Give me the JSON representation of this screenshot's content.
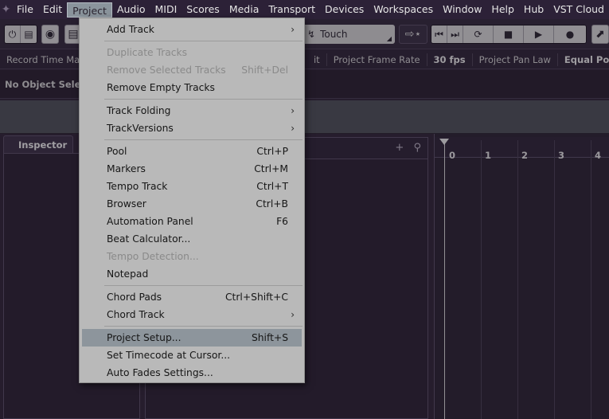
{
  "menubar": {
    "items": [
      "File",
      "Edit",
      "Project",
      "Audio",
      "MIDI",
      "Scores",
      "Media",
      "Transport",
      "Devices",
      "Workspaces",
      "Window",
      "Help",
      "Hub",
      "VST Cloud"
    ],
    "active": "Project"
  },
  "toolbar": {
    "automation_mode": "Touch"
  },
  "infoline": {
    "record_time_label": "Record Time Max",
    "cut_label": "it",
    "frame_rate_label": "Project Frame Rate",
    "frame_rate_value": "30 fps",
    "pan_law_label": "Project Pan Law",
    "pan_law_value": "Equal Power"
  },
  "event_line": {
    "status": "No Object Selected"
  },
  "inspector": {
    "tab_label": "Inspector"
  },
  "ruler": {
    "ticks": [
      "0",
      "1",
      "2",
      "3",
      "4"
    ]
  },
  "project_menu": {
    "items": [
      {
        "label": "Add Track",
        "shortcut": "",
        "submenu": true,
        "disabled": false,
        "highlight": false
      },
      {
        "label": "Duplicate Tracks",
        "shortcut": "",
        "submenu": false,
        "disabled": true,
        "highlight": false
      },
      {
        "label": "Remove Selected Tracks",
        "shortcut": "Shift+Del",
        "submenu": false,
        "disabled": true,
        "highlight": false
      },
      {
        "label": "Remove Empty Tracks",
        "shortcut": "",
        "submenu": false,
        "disabled": false,
        "highlight": false
      },
      {
        "label": "Track Folding",
        "shortcut": "",
        "submenu": true,
        "disabled": false,
        "highlight": false
      },
      {
        "label": "TrackVersions",
        "shortcut": "",
        "submenu": true,
        "disabled": false,
        "highlight": false
      },
      {
        "label": "Pool",
        "shortcut": "Ctrl+P",
        "submenu": false,
        "disabled": false,
        "highlight": false
      },
      {
        "label": "Markers",
        "shortcut": "Ctrl+M",
        "submenu": false,
        "disabled": false,
        "highlight": false
      },
      {
        "label": "Tempo Track",
        "shortcut": "Ctrl+T",
        "submenu": false,
        "disabled": false,
        "highlight": false
      },
      {
        "label": "Browser",
        "shortcut": "Ctrl+B",
        "submenu": false,
        "disabled": false,
        "highlight": false
      },
      {
        "label": "Automation Panel",
        "shortcut": "F6",
        "submenu": false,
        "disabled": false,
        "highlight": false
      },
      {
        "label": "Beat Calculator...",
        "shortcut": "",
        "submenu": false,
        "disabled": false,
        "highlight": false
      },
      {
        "label": "Tempo Detection...",
        "shortcut": "",
        "submenu": false,
        "disabled": true,
        "highlight": false
      },
      {
        "label": "Notepad",
        "shortcut": "",
        "submenu": false,
        "disabled": false,
        "highlight": false
      },
      {
        "label": "Chord Pads",
        "shortcut": "Ctrl+Shift+C",
        "submenu": false,
        "disabled": false,
        "highlight": false
      },
      {
        "label": "Chord Track",
        "shortcut": "",
        "submenu": true,
        "disabled": false,
        "highlight": false
      },
      {
        "label": "Project Setup...",
        "shortcut": "Shift+S",
        "submenu": false,
        "disabled": false,
        "highlight": true
      },
      {
        "label": "Set Timecode at Cursor...",
        "shortcut": "",
        "submenu": false,
        "disabled": false,
        "highlight": false
      },
      {
        "label": "Auto Fades Settings...",
        "shortcut": "",
        "submenu": false,
        "disabled": false,
        "highlight": false
      }
    ]
  }
}
